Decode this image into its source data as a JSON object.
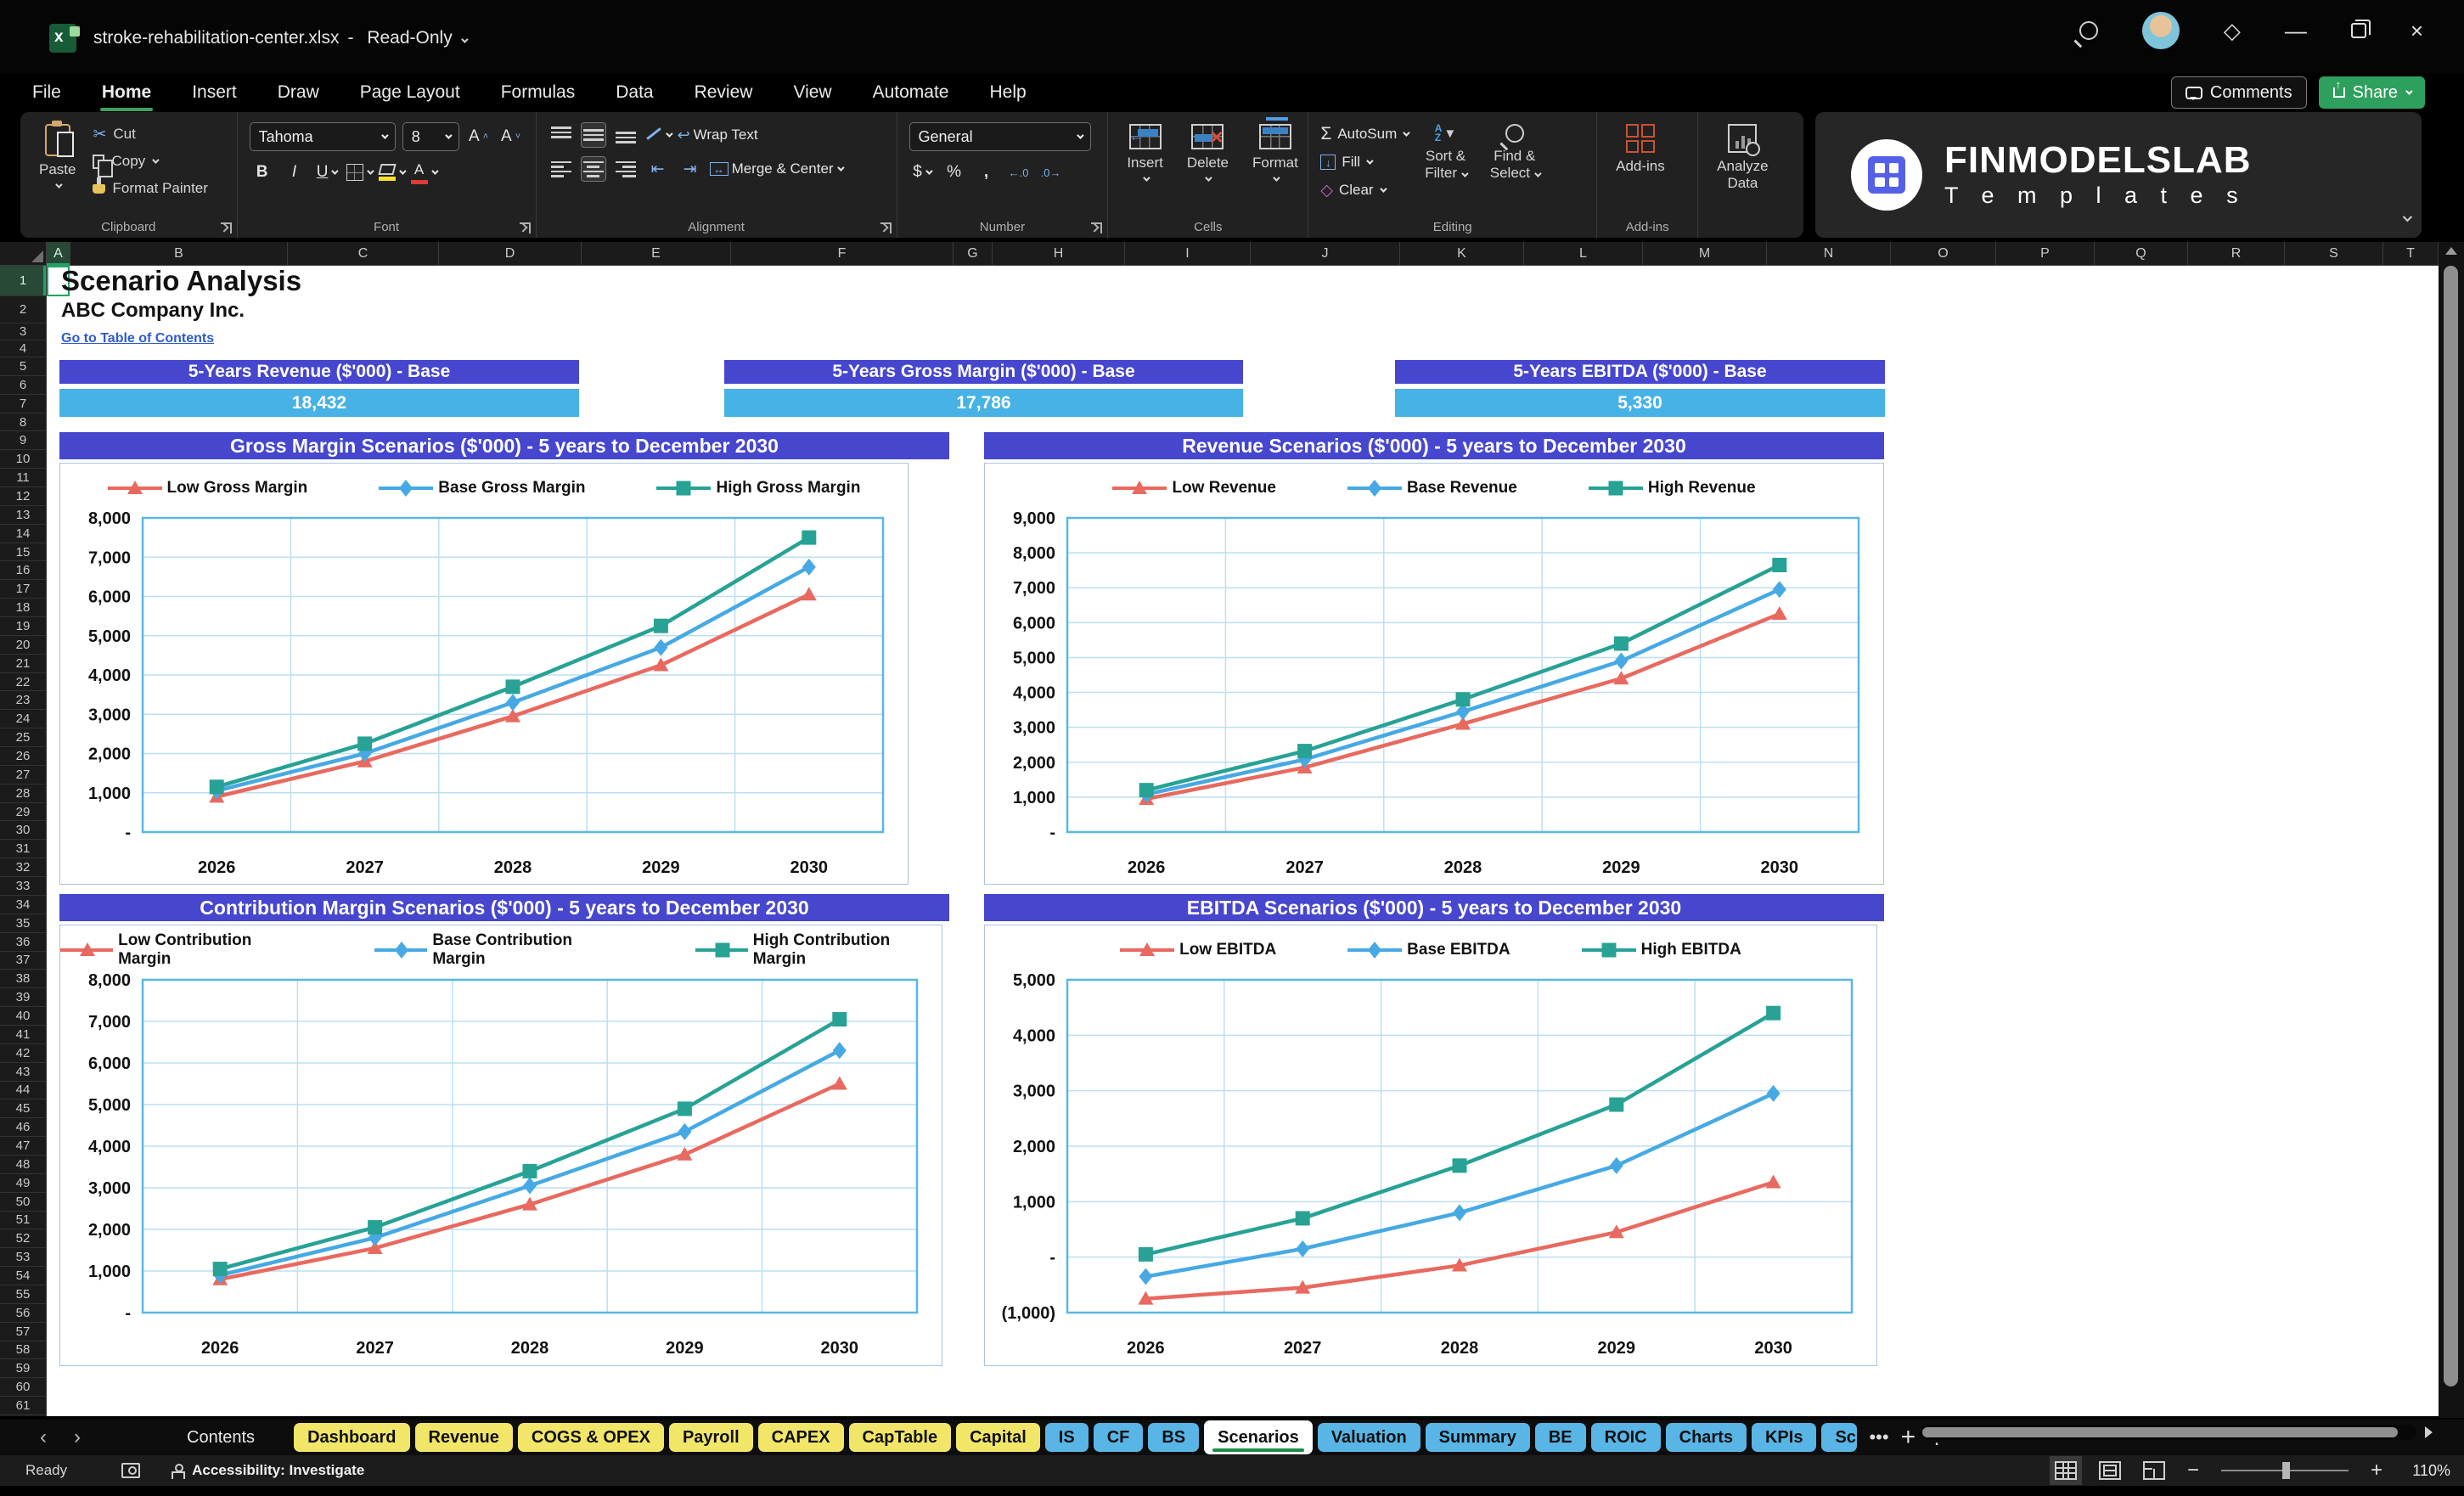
{
  "window": {
    "title_filename": "stroke-rehabilitation-center.xlsx",
    "title_separator": "-",
    "title_mode": "Read-Only"
  },
  "collab": {
    "comments": "Comments",
    "share": "Share"
  },
  "brand": {
    "name": "FINMODELSLAB",
    "subtitle": "T e m p l a t e s"
  },
  "menu": {
    "items": [
      "File",
      "Home",
      "Insert",
      "Draw",
      "Page Layout",
      "Formulas",
      "Data",
      "Review",
      "View",
      "Automate",
      "Help"
    ],
    "active": "Home"
  },
  "ribbon": {
    "clipboard": {
      "paste": "Paste",
      "cut": "Cut",
      "copy": "Copy",
      "format_painter": "Format Painter",
      "group": "Clipboard"
    },
    "font": {
      "font_name": "Tahoma",
      "font_size": "8",
      "bold": "B",
      "italic": "I",
      "underline": "U",
      "group": "Font"
    },
    "alignment": {
      "wrap_text": "Wrap Text",
      "merge_center": "Merge & Center",
      "group": "Alignment"
    },
    "number": {
      "format": "General",
      "currency": "$",
      "percent": "%",
      "comma": ",",
      "inc_decimal": "←.0",
      "dec_decimal": ".0→",
      "group": "Number"
    },
    "cells": {
      "insert": "Insert",
      "delete": "Delete",
      "format": "Format",
      "group": "Cells"
    },
    "editing": {
      "sigma": "Σ",
      "autosum": "AutoSum",
      "fill": "Fill",
      "clear": "Clear",
      "sort_a": "A",
      "sort_z": "Z",
      "sort_filter_1": "Sort &",
      "sort_filter_2": "Filter",
      "find_select_1": "Find &",
      "find_select_2": "Select",
      "group": "Editing"
    },
    "addins": {
      "label": "Add-ins",
      "group": "Add-ins"
    },
    "analyze": {
      "label_1": "Analyze",
      "label_2": "Data"
    }
  },
  "grid": {
    "columns": [
      "A",
      "B",
      "C",
      "D",
      "E",
      "F",
      "G",
      "H",
      "I",
      "J",
      "K",
      "L",
      "M",
      "N",
      "O",
      "P",
      "Q",
      "R",
      "S",
      "T"
    ],
    "rows": [
      1,
      2,
      3,
      4,
      5,
      6,
      7,
      8,
      9,
      10,
      11,
      12,
      13,
      14,
      15,
      16,
      17,
      18,
      19,
      20,
      21,
      22,
      23,
      24,
      25,
      26,
      27,
      28,
      29,
      30,
      31,
      32,
      33,
      34,
      35,
      36,
      37,
      38,
      39,
      40,
      41,
      42,
      43,
      44,
      45,
      46,
      47,
      48,
      49,
      50,
      51,
      52,
      53,
      54,
      55,
      56,
      57,
      58,
      59,
      60,
      61
    ],
    "selected_column": "A",
    "selected_row": 1
  },
  "sheet": {
    "title": "Scenario Analysis",
    "company": "ABC Company Inc.",
    "link": "Go to Table of Contents",
    "kpis": [
      {
        "label": "5-Years Revenue ($'000) - Base",
        "value": "18,432"
      },
      {
        "label": "5-Years Gross Margin ($'000) - Base",
        "value": "17,786"
      },
      {
        "label": "5-Years EBITDA ($'000) - Base",
        "value": "5,330"
      }
    ]
  },
  "chart_data": [
    {
      "type": "line",
      "title": "Gross Margin Scenarios ($'000) - 5 years to December 2030",
      "categories": [
        "2026",
        "2027",
        "2028",
        "2029",
        "2030"
      ],
      "series": [
        {
          "name": "Low Gross Margin",
          "color": "#E8695F",
          "marker": "triangle",
          "values": [
            900,
            1800,
            2950,
            4250,
            6050
          ]
        },
        {
          "name": "Base Gross Margin",
          "color": "#46A9E3",
          "marker": "diamond",
          "values": [
            1050,
            2000,
            3300,
            4700,
            6750
          ]
        },
        {
          "name": "High Gross Margin",
          "color": "#27A295",
          "marker": "square",
          "values": [
            1150,
            2250,
            3700,
            5250,
            7500
          ]
        }
      ],
      "ylim": [
        0,
        8000
      ],
      "yticks": [
        "8,000",
        "7,000",
        "6,000",
        "5,000",
        "4,000",
        "3,000",
        "2,000",
        "1,000",
        "-"
      ],
      "grid": true,
      "legend_position": "top"
    },
    {
      "type": "line",
      "title": "Revenue Scenarios ($'000) - 5 years to December 2030",
      "categories": [
        "2026",
        "2027",
        "2028",
        "2029",
        "2030"
      ],
      "series": [
        {
          "name": "Low Revenue",
          "color": "#E8695F",
          "marker": "triangle",
          "values": [
            950,
            1850,
            3100,
            4400,
            6250
          ]
        },
        {
          "name": "Base Revenue",
          "color": "#46A9E3",
          "marker": "diamond",
          "values": [
            1080,
            2080,
            3450,
            4900,
            6950
          ]
        },
        {
          "name": "High Revenue",
          "color": "#27A295",
          "marker": "square",
          "values": [
            1200,
            2320,
            3800,
            5400,
            7650
          ]
        }
      ],
      "ylim": [
        0,
        9000
      ],
      "yticks": [
        "9,000",
        "8,000",
        "7,000",
        "6,000",
        "5,000",
        "4,000",
        "3,000",
        "2,000",
        "1,000",
        "-"
      ],
      "grid": true,
      "legend_position": "top"
    },
    {
      "type": "line",
      "title": "Contribution Margin Scenarios ($'000) - 5 years to December 2030",
      "categories": [
        "2026",
        "2027",
        "2028",
        "2029",
        "2030"
      ],
      "series": [
        {
          "name": "Low Contribution Margin",
          "color": "#E8695F",
          "marker": "triangle",
          "values": [
            800,
            1550,
            2600,
            3800,
            5500
          ]
        },
        {
          "name": "Base Contribution Margin",
          "color": "#46A9E3",
          "marker": "diamond",
          "values": [
            900,
            1800,
            3050,
            4350,
            6300
          ]
        },
        {
          "name": "High Contribution Margin",
          "color": "#27A295",
          "marker": "square",
          "values": [
            1050,
            2050,
            3400,
            4900,
            7050
          ]
        }
      ],
      "ylim": [
        0,
        8000
      ],
      "yticks": [
        "8,000",
        "7,000",
        "6,000",
        "5,000",
        "4,000",
        "3,000",
        "2,000",
        "1,000",
        "-"
      ],
      "grid": true,
      "legend_position": "top"
    },
    {
      "type": "line",
      "title": "EBITDA Scenarios ($'000) - 5 years to December 2030",
      "categories": [
        "2026",
        "2027",
        "2028",
        "2029",
        "2030"
      ],
      "series": [
        {
          "name": "Low EBITDA",
          "color": "#E8695F",
          "marker": "triangle",
          "values": [
            -750,
            -550,
            -150,
            450,
            1350
          ]
        },
        {
          "name": "Base EBITDA",
          "color": "#46A9E3",
          "marker": "diamond",
          "values": [
            -350,
            150,
            800,
            1650,
            2950
          ]
        },
        {
          "name": "High EBITDA",
          "color": "#27A295",
          "marker": "square",
          "values": [
            50,
            700,
            1650,
            2750,
            4400
          ]
        }
      ],
      "ylim": [
        -1000,
        5000
      ],
      "yticks": [
        "5,000",
        "4,000",
        "3,000",
        "2,000",
        "1,000",
        "-",
        "(1,000)"
      ],
      "grid": true,
      "legend_position": "top"
    }
  ],
  "tabs": {
    "items": [
      {
        "label": "Contents",
        "style": "plain"
      },
      {
        "label": "Dashboard",
        "style": "yellow"
      },
      {
        "label": "Revenue",
        "style": "yellow"
      },
      {
        "label": "COGS & OPEX",
        "style": "yellow"
      },
      {
        "label": "Payroll",
        "style": "yellow"
      },
      {
        "label": "CAPEX",
        "style": "yellow"
      },
      {
        "label": "CapTable",
        "style": "yellow"
      },
      {
        "label": "Capital",
        "style": "yellow"
      },
      {
        "label": "IS",
        "style": "blue"
      },
      {
        "label": "CF",
        "style": "blue"
      },
      {
        "label": "BS",
        "style": "blue"
      },
      {
        "label": "Scenarios",
        "style": "active"
      },
      {
        "label": "Valuation",
        "style": "blue"
      },
      {
        "label": "Summary",
        "style": "blue"
      },
      {
        "label": "BE",
        "style": "blue"
      },
      {
        "label": "ROIC",
        "style": "blue"
      },
      {
        "label": "Charts",
        "style": "blue"
      },
      {
        "label": "KPIs",
        "style": "blue"
      },
      {
        "label": "Sc",
        "style": "blue cut"
      }
    ],
    "overflow": "•••",
    "add": "+",
    "menu": "⋮"
  },
  "statusbar": {
    "ready": "Ready",
    "accessibility": "Accessibility: Investigate",
    "zoom": "110%"
  },
  "colors": {
    "banner_purple": "#4646CE",
    "kpi_value_blue": "#47B2E5",
    "series_low": "#E8695F",
    "series_base": "#46A9E3",
    "series_high": "#27A295",
    "tab_yellow": "#F2E669",
    "tab_blue": "#58B5E5",
    "active_green": "#1E8A4C"
  }
}
